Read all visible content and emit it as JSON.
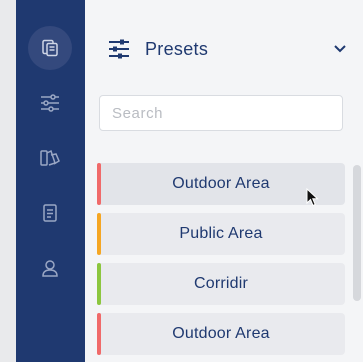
{
  "sidebar": {
    "items": [
      {
        "icon": "copy-icon",
        "active": true
      },
      {
        "icon": "sliders-icon",
        "active": false
      },
      {
        "icon": "swatches-icon",
        "active": false
      },
      {
        "icon": "document-icon",
        "active": false
      },
      {
        "icon": "user-icon",
        "active": false
      }
    ],
    "bg_color": "#1f3970"
  },
  "panel": {
    "title": "Presets",
    "header_icon": "sliders-icon",
    "collapse_icon": "chevron-down-icon"
  },
  "search": {
    "placeholder": "Search",
    "value": ""
  },
  "presets": [
    {
      "label": "Outdoor Area",
      "color": "#f06a6a"
    },
    {
      "label": "Public Area",
      "color": "#f5a623"
    },
    {
      "label": "Corridir",
      "color": "#8cc63f"
    },
    {
      "label": "Outdoor Area",
      "color": "#f06a6a"
    }
  ],
  "accent_color": "#1f3970"
}
